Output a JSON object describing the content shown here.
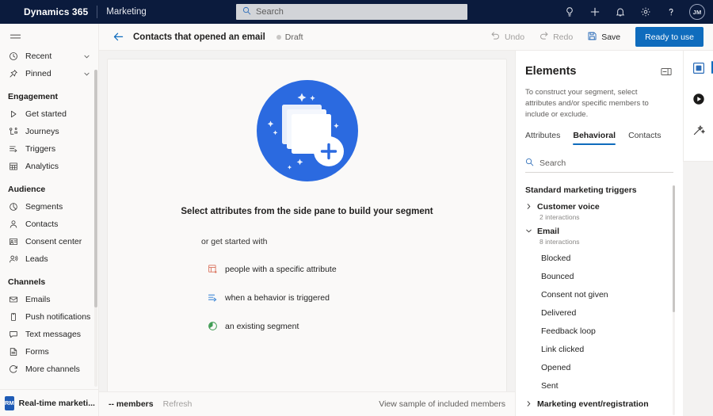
{
  "topnav": {
    "brand": "Dynamics 365",
    "app": "Marketing",
    "search_placeholder": "Search",
    "icons": [
      {
        "name": "lightbulb-icon",
        "label": "Insights"
      },
      {
        "name": "plus-icon",
        "label": "New"
      },
      {
        "name": "bell-icon",
        "label": "Notifications"
      },
      {
        "name": "gear-icon",
        "label": "Settings"
      },
      {
        "name": "question-icon",
        "label": "Help"
      }
    ],
    "avatar_initials": "JM",
    "background": "#0b1b3d"
  },
  "sidebar": {
    "quick": [
      {
        "label": "Recent",
        "icon": "clock-icon",
        "chevron": true
      },
      {
        "label": "Pinned",
        "icon": "pin-icon",
        "chevron": true
      }
    ],
    "groups": [
      {
        "header": "Engagement",
        "items": [
          {
            "label": "Get started",
            "icon": "play-icon"
          },
          {
            "label": "Journeys",
            "icon": "journeys-icon"
          },
          {
            "label": "Triggers",
            "icon": "triggers-icon"
          },
          {
            "label": "Analytics",
            "icon": "analytics-icon"
          }
        ]
      },
      {
        "header": "Audience",
        "items": [
          {
            "label": "Segments",
            "icon": "segments-icon"
          },
          {
            "label": "Contacts",
            "icon": "contact-icon"
          },
          {
            "label": "Consent center",
            "icon": "consent-icon"
          },
          {
            "label": "Leads",
            "icon": "leads-icon"
          }
        ]
      },
      {
        "header": "Channels",
        "items": [
          {
            "label": "Emails",
            "icon": "email-icon"
          },
          {
            "label": "Push notifications",
            "icon": "push-icon"
          },
          {
            "label": "Text messages",
            "icon": "sms-icon"
          },
          {
            "label": "Forms",
            "icon": "forms-icon"
          },
          {
            "label": "More channels",
            "icon": "more-channels-icon"
          }
        ]
      }
    ],
    "footer": {
      "badge": "RM",
      "label": "Real-time marketi..."
    }
  },
  "commandbar": {
    "back_label": "Back",
    "title": "Contacts that opened an email",
    "status": "Draft",
    "undo": "Undo",
    "redo": "Redo",
    "save": "Save",
    "primary": "Ready to use",
    "primary_color": "#0f6cbd"
  },
  "canvas": {
    "empty_title": "Select attributes from the side pane to build your segment",
    "empty_sub": "or get started with",
    "quickstart": [
      {
        "label": "people with a specific attribute",
        "icon": "table-attribute-icon",
        "color": "#d9715b"
      },
      {
        "label": "when a behavior is triggered",
        "icon": "trigger-flow-icon",
        "color": "#2b7cd3"
      },
      {
        "label": "an existing segment",
        "icon": "existing-segment-icon",
        "color": "#3f9c53"
      }
    ]
  },
  "statusbar": {
    "members": "-- members",
    "refresh": "Refresh",
    "sample": "View sample of included members"
  },
  "elements": {
    "title": "Elements",
    "description": "To construct your segment, select attributes and/or specific members to include or exclude.",
    "tabs": [
      {
        "label": "Attributes",
        "active": false
      },
      {
        "label": "Behavioral",
        "active": true
      },
      {
        "label": "Contacts",
        "active": false
      }
    ],
    "search_placeholder": "Search",
    "tree_header": "Standard marketing triggers",
    "groups": [
      {
        "label": "Customer voice",
        "sub": "2 interactions",
        "expanded": false,
        "items": []
      },
      {
        "label": "Email",
        "sub": "8 interactions",
        "expanded": true,
        "items": [
          "Blocked",
          "Bounced",
          "Consent not given",
          "Delivered",
          "Feedback loop",
          "Link clicked",
          "Opened",
          "Sent"
        ]
      },
      {
        "label": "Marketing event/registration",
        "sub": "",
        "expanded": false,
        "items": []
      }
    ]
  },
  "rail": {
    "items": [
      {
        "name": "elements-panel-icon",
        "active": true
      },
      {
        "name": "copilot-icon",
        "active": false
      },
      {
        "name": "wand-icon",
        "active": false
      }
    ]
  }
}
